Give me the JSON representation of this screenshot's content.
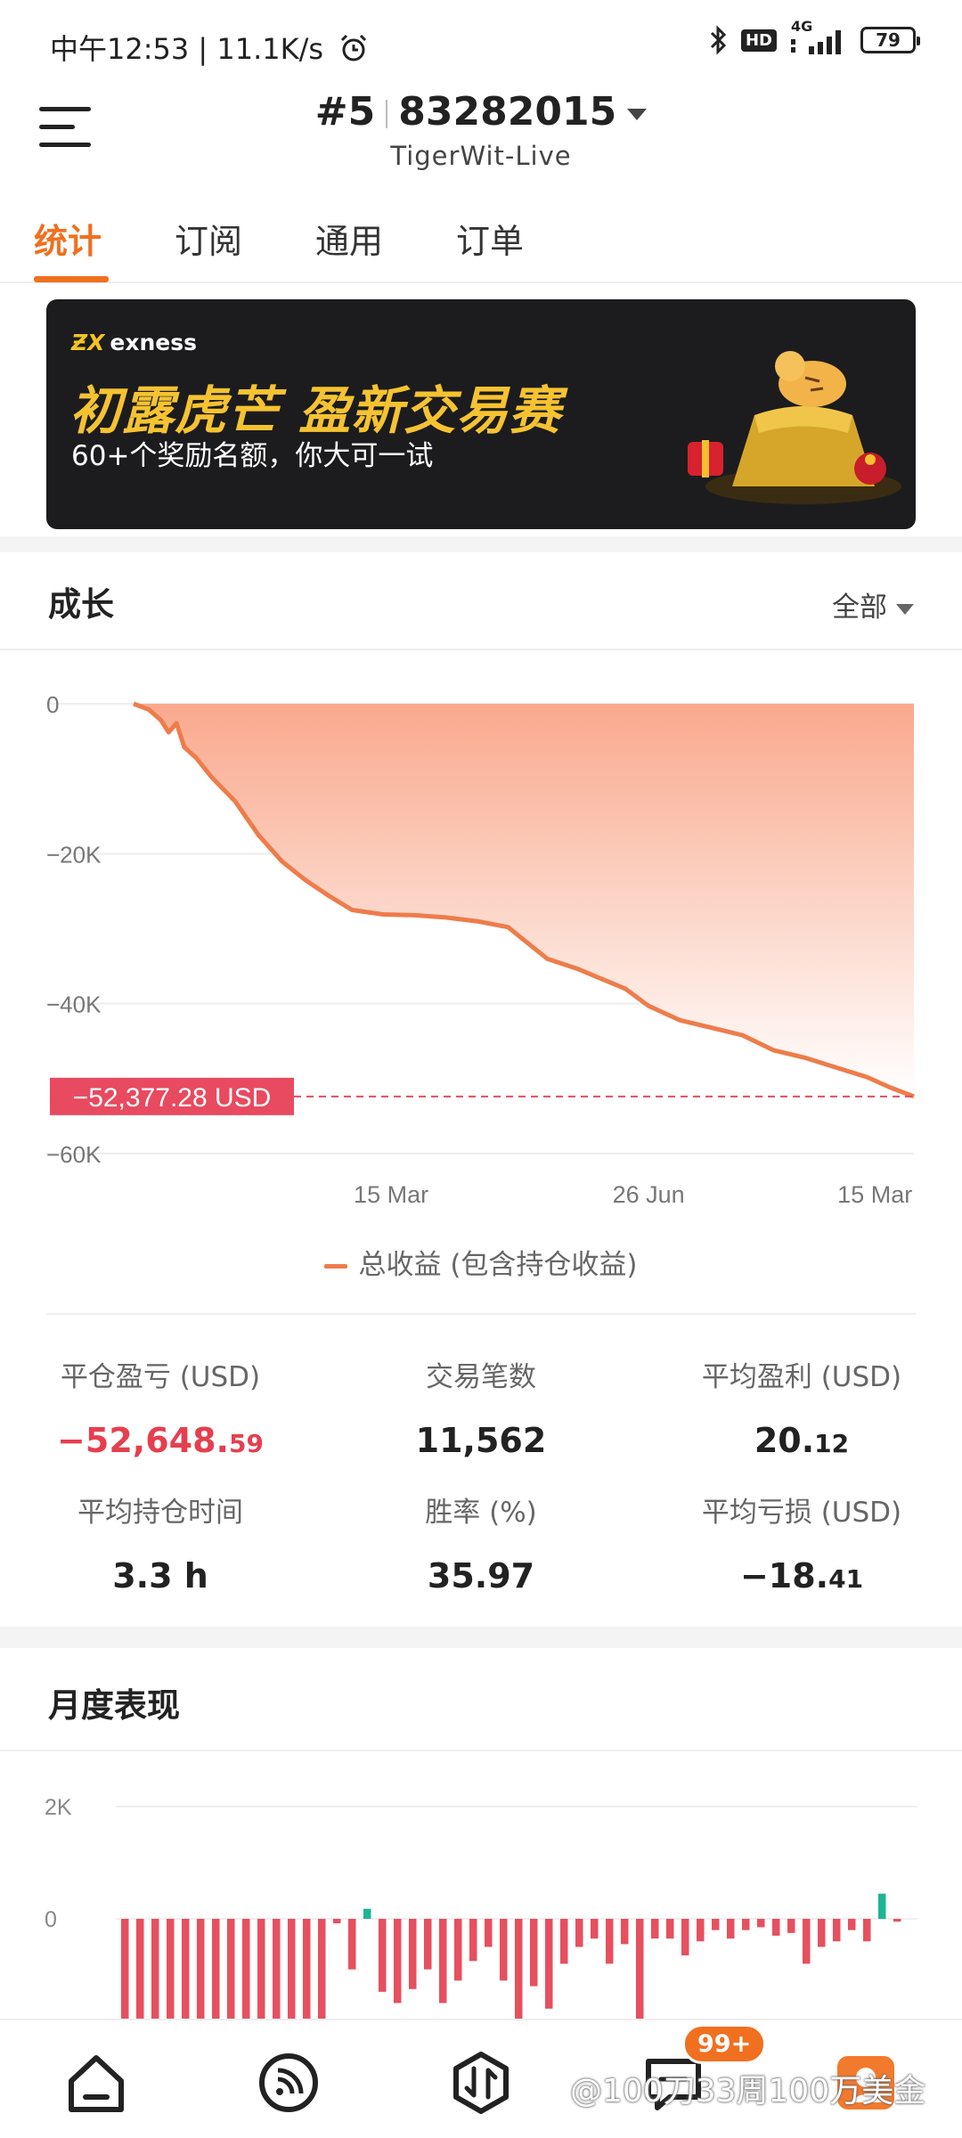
{
  "status_bar": {
    "time": "中午12:53",
    "speed": "11.1K/s",
    "hd": "HD",
    "network": "4G",
    "battery": "79",
    "icons": [
      "alarm-icon",
      "bluetooth-icon",
      "signal-icon",
      "battery-icon"
    ]
  },
  "header": {
    "account_index": "#5",
    "account_number": "83282015",
    "server": "TigerWit-Live"
  },
  "tabs": [
    {
      "label": "统计",
      "active": true
    },
    {
      "label": "订阅",
      "active": false
    },
    {
      "label": "通用",
      "active": false
    },
    {
      "label": "订单",
      "active": false
    }
  ],
  "banner": {
    "brand": "exness",
    "title": "初露虎芒 盈新交易赛",
    "subtitle": "60+个奖励名额，你大可一试"
  },
  "growth": {
    "title": "成长",
    "filter": "全部",
    "current_label": "−52,377.28 USD",
    "legend": "总收益 (包含持仓收益)"
  },
  "chart_data": [
    {
      "type": "area",
      "series": [
        {
          "name": "总收益 (包含持仓收益)",
          "points": [
            [
              0,
              0
            ],
            [
              0.02,
              -800
            ],
            [
              0.035,
              -2200
            ],
            [
              0.045,
              -3800
            ],
            [
              0.055,
              -2600
            ],
            [
              0.065,
              -5800
            ],
            [
              0.08,
              -7200
            ],
            [
              0.1,
              -9800
            ],
            [
              0.13,
              -13000
            ],
            [
              0.16,
              -17500
            ],
            [
              0.19,
              -21000
            ],
            [
              0.22,
              -23500
            ],
            [
              0.25,
              -25600
            ],
            [
              0.28,
              -27500
            ],
            [
              0.32,
              -28100
            ],
            [
              0.36,
              -28200
            ],
            [
              0.4,
              -28500
            ],
            [
              0.44,
              -29000
            ],
            [
              0.48,
              -29800
            ],
            [
              0.5,
              -31500
            ],
            [
              0.53,
              -34000
            ],
            [
              0.57,
              -35400
            ],
            [
              0.6,
              -36700
            ],
            [
              0.63,
              -38000
            ],
            [
              0.66,
              -40300
            ],
            [
              0.7,
              -42200
            ],
            [
              0.74,
              -43200
            ],
            [
              0.78,
              -44200
            ],
            [
              0.82,
              -46200
            ],
            [
              0.86,
              -47200
            ],
            [
              0.9,
              -48500
            ],
            [
              0.94,
              -49800
            ],
            [
              0.97,
              -51200
            ],
            [
              1.0,
              -52377.28
            ]
          ]
        }
      ],
      "x_tick_labels": [
        "15 Mar",
        "26 Jun",
        "15 Mar"
      ],
      "x_tick_positions": [
        0.33,
        0.66,
        0.95
      ],
      "y_ticks": [
        "0",
        "−20K",
        "−40K",
        "−60K"
      ],
      "ylim": [
        -60000,
        0
      ],
      "grid": true,
      "colors": {
        "line": "#ee7c4b",
        "fill_top": "#f9a98d",
        "fill_bottom": "#ffffff",
        "marker": "#e84a5f"
      },
      "current_value": -52377.28
    },
    {
      "type": "bar",
      "title": "月度表现",
      "y_ticks": [
        "2K",
        "0"
      ],
      "ylim_visible": [
        -1800,
        2000
      ],
      "values": [
        -1800,
        -1800,
        -1800,
        -1800,
        -1800,
        -1800,
        -1800,
        -1800,
        -1800,
        -1800,
        -1800,
        -1800,
        -1800,
        -1800,
        -80,
        -900,
        180,
        -1300,
        -1500,
        -1250,
        -900,
        -1500,
        -1100,
        -750,
        -500,
        -1100,
        -1800,
        -1200,
        -1600,
        -800,
        -500,
        -350,
        -800,
        -450,
        -1800,
        -350,
        -350,
        -650,
        -400,
        -200,
        -350,
        -200,
        -150,
        -300,
        -250,
        -800,
        -500,
        -400,
        -200,
        -400,
        450,
        -50
      ],
      "colors": {
        "negative": "#e6505f",
        "positive": "#1fb590"
      }
    }
  ],
  "stats": [
    {
      "label": "平仓盈亏 (USD)",
      "int": "−52,648.",
      "dec": "59",
      "negative": true
    },
    {
      "label": "交易笔数",
      "int": "11,562",
      "dec": "",
      "negative": false
    },
    {
      "label": "平均盈利 (USD)",
      "int": "20.",
      "dec": "12",
      "negative": false
    },
    {
      "label": "平均持仓时间",
      "int": "3.3 h",
      "dec": "",
      "negative": false
    },
    {
      "label": "胜率 (%)",
      "int": "35.97",
      "dec": "",
      "negative": false
    },
    {
      "label": "平均亏损 (USD)",
      "int": "−18.",
      "dec": "41",
      "negative": false
    }
  ],
  "monthly": {
    "title": "月度表现"
  },
  "bottom_nav": {
    "items": [
      "home-icon",
      "feed-icon",
      "trade-icon",
      "message-icon",
      "profile-icon"
    ],
    "badge": "99+",
    "watermark": "@100刀33周100万美金"
  }
}
